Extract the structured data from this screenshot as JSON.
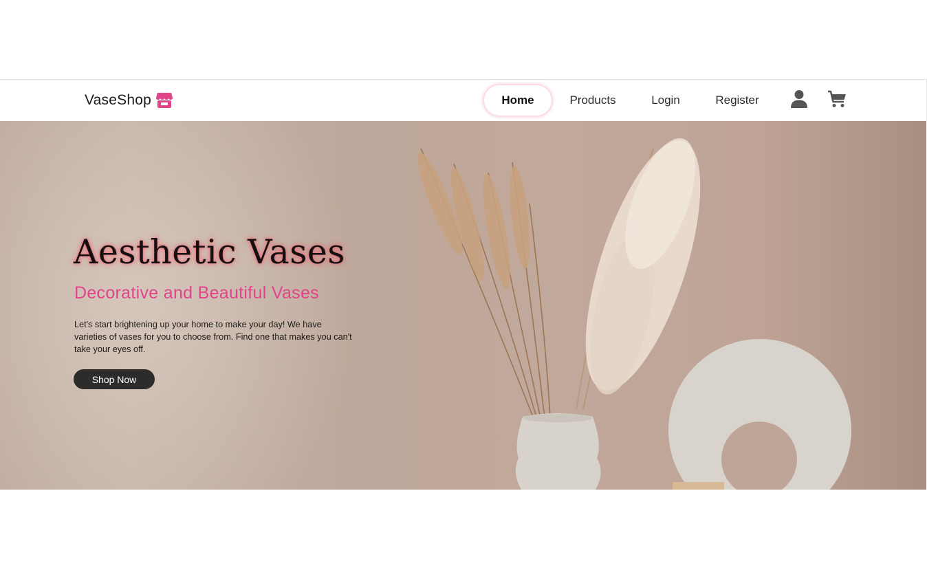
{
  "navbar": {
    "brand_name": "VaseShop",
    "brand_icon": "store-icon",
    "links": [
      {
        "label": "Home",
        "active": true
      },
      {
        "label": "Products",
        "active": false
      },
      {
        "label": "Login",
        "active": false
      },
      {
        "label": "Register",
        "active": false
      }
    ],
    "icons": [
      "user-icon",
      "cart-icon"
    ]
  },
  "hero": {
    "title": "Aesthetic Vases",
    "subtitle": "Decorative and Beautiful Vases",
    "description": "Let's start brightening up your home to make your day! We have varieties of vases for you to choose from. Find one that makes you can't take your eyes off.",
    "button_label": "Shop Now",
    "image": "pampas-grass-and-white-vases-photo"
  },
  "colors": {
    "accent": "#e0458a",
    "button_bg": "#2e2c2b",
    "icon_gray": "#555555"
  }
}
